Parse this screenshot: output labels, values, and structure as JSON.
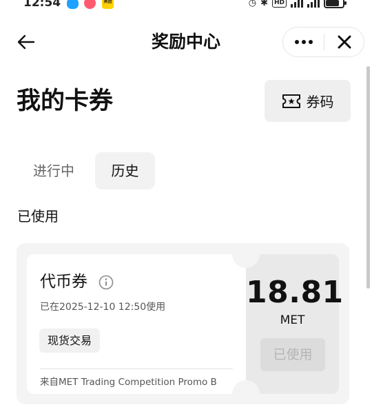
{
  "status_bar": {
    "time": "12:54",
    "apps": [
      "qq-icon",
      "game-icon",
      "meituan-icon"
    ],
    "meituan_label": "美团",
    "hd_label": "HD",
    "battery_level": 0.8
  },
  "nav": {
    "title": "奖励中心",
    "icons": {
      "back": "arrow-left-icon",
      "more": "more-dots-icon",
      "close": "close-icon"
    }
  },
  "header": {
    "title": "我的卡券",
    "coupon_code_label": "券码",
    "coupon_code_icon": "ticket-star-icon"
  },
  "tabs": [
    {
      "label": "进行中",
      "active": false
    },
    {
      "label": "历史",
      "active": true
    }
  ],
  "section": {
    "label": "已使用"
  },
  "coupons": [
    {
      "name": "代币券",
      "used_time": "已在2025-12-10 12:50使用",
      "tag": "现货交易",
      "source": "来自MET Trading Competition Promo B",
      "amount": "18.81",
      "unit": "MET",
      "status_label": "已使用"
    }
  ],
  "colors": {
    "text_primary": "#111111",
    "text_secondary": "#555555",
    "card_bg": "#f4f4f4",
    "card_stub_bg": "#e9e9e9",
    "disabled_button_bg": "#dcdcdc",
    "disabled_button_text": "#b5b5b5"
  }
}
